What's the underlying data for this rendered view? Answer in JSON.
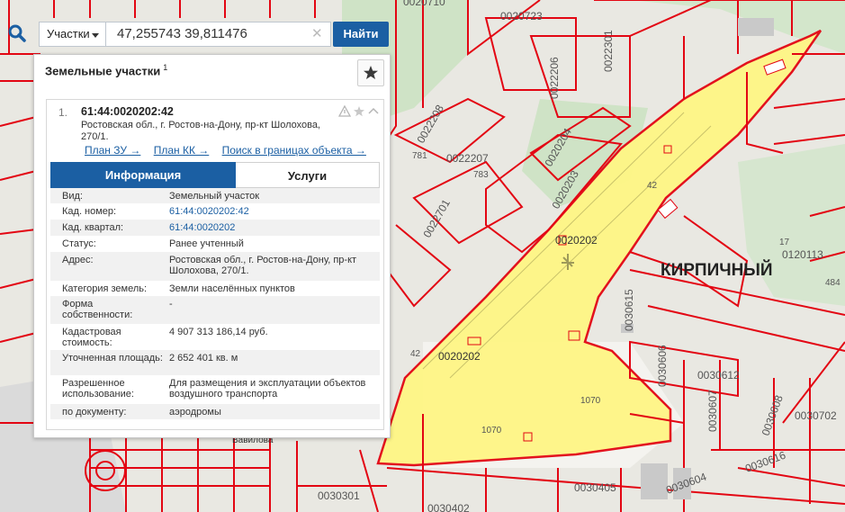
{
  "search": {
    "layer": "Участки",
    "value": "47,255743 39,811476",
    "button": "Найти"
  },
  "panel": {
    "title": "Земельные участки",
    "count": "1"
  },
  "result": {
    "index": "1.",
    "cad_number": "61:44:0020202:42",
    "address": "Ростовская обл., г. Ростов-на-Дону, пр-кт Шолохова, 270/1.",
    "links": [
      "План ЗУ →",
      "План КК →",
      "Поиск в границах объекта →"
    ],
    "tabs": {
      "info": "Информация",
      "services": "Услуги"
    },
    "rows": [
      {
        "k": "Вид:",
        "v": "Земельный участок"
      },
      {
        "k": "Кад. номер:",
        "v": "61:44:0020202:42"
      },
      {
        "k": "Кад. квартал:",
        "v": "61:44:0020202"
      },
      {
        "k": "Статус:",
        "v": "Ранее учтенный"
      },
      {
        "k": "Адрес:",
        "v": "Ростовская обл., г. Ростов-на-Дону, пр-кт Шолохова, 270/1."
      },
      {
        "k": "Категория земель:",
        "v": "Земли населённых пунктов"
      },
      {
        "k": "Форма собственности:",
        "v": "-"
      },
      {
        "k": "Кадастровая стоимость:",
        "v": "4 907 313 186,14 руб."
      },
      {
        "k": "Уточненная площадь:",
        "v": "2 652 401 кв. м"
      },
      {
        "k": "Разрешенное использование:",
        "v": "Для размещения и эксплуатации объектов воздушного транспорта"
      },
      {
        "k": "по документу:",
        "v": "аэродромы"
      }
    ]
  },
  "map": {
    "district": "КИРПИЧНЫЙ",
    "labels": [
      "0020202",
      "0020202",
      "0020204",
      "0020203",
      "0022701",
      "0022207",
      "0022208",
      "0022206",
      "0022301",
      "0020723",
      "0020710",
      "0030615",
      "0030606",
      "0030607",
      "0030608",
      "0030612",
      "0030702",
      "0030616",
      "0030604",
      "0030405",
      "0030301",
      "0030402",
      "0120113",
      "42",
      "42",
      "1070",
      "1070",
      "17",
      "484",
      "783",
      "781",
      "Вавилова"
    ]
  },
  "colors": {
    "parcel_highlight": "#fff685",
    "parcel_border": "#e30613",
    "accent": "#1b5fa3"
  }
}
